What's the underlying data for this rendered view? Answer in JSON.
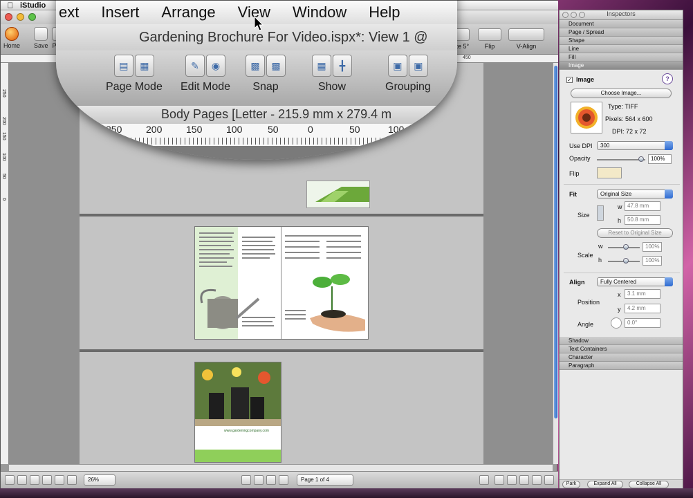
{
  "menubar": {
    "app_name": "iStudio"
  },
  "magnifier": {
    "menu_items": [
      "ext",
      "Insert",
      "Arrange",
      "View",
      "Window",
      "Help"
    ],
    "window_title": "Gardening Brochure For Video.ispx*: View 1 @",
    "tools": [
      {
        "label": "Page Mode"
      },
      {
        "label": "Edit Mode"
      },
      {
        "label": "Snap"
      },
      {
        "label": "Show"
      },
      {
        "label": "Grouping"
      }
    ],
    "header": "Body Pages  [Letter - 215.9 mm x 279.4 m",
    "ruler_ticks": [
      "250",
      "200",
      "150",
      "100",
      "50",
      "0",
      "50",
      "100"
    ]
  },
  "toolbar": {
    "home": "Home",
    "save": "Save",
    "print_partial": "Pr",
    "rotate_partial": "tate 5°",
    "flip": "Flip",
    "valign": "V-Align"
  },
  "ruler": {
    "right_label": "450",
    "left_ticks": [
      "250",
      "200",
      "150",
      "100",
      "50",
      "0"
    ]
  },
  "status": {
    "zoom": "26%",
    "page": "Page 1 of 4"
  },
  "inspector": {
    "title": "Inspectors",
    "sections_top": [
      "Document",
      "Page / Spread",
      "Shape",
      "Line",
      "Fill",
      "Image"
    ],
    "image": {
      "checkbox_label": "Image",
      "choose_button": "Choose Image...",
      "type": "Type:  TIFF",
      "pixels": "Pixels:  564 x 600",
      "dpi": "DPI:  72 x 72",
      "use_dpi_label": "Use DPI",
      "use_dpi_value": "300",
      "opacity_label": "Opacity",
      "opacity_value": "100%",
      "flip_label": "Flip",
      "fit_label": "Fit",
      "fit_value": "Original Size",
      "size_label": "Size",
      "w_label": "w",
      "w_value": "47.8 mm",
      "h_label": "h",
      "h_value": "50.8 mm",
      "reset_button": "Reset to Original Size",
      "scale_label": "Scale",
      "scale_w": "100%",
      "scale_h": "100%",
      "align_label": "Align",
      "align_value": "Fully Centered",
      "position_label": "Position",
      "x_label": "x",
      "x_value": "3.1 mm",
      "y_label": "y",
      "y_value": "4.2 mm",
      "angle_label": "Angle",
      "angle_value": "0.0°",
      "help": "?"
    },
    "sections_bottom": [
      "Shadow",
      "Text Containers",
      "Character",
      "Paragraph"
    ],
    "footer": [
      "Park",
      "Expand All",
      "Collapse All"
    ]
  },
  "brochure": {
    "url_text": "www.gardeningcompany.com"
  },
  "colors": {
    "accent_blue": "#2e6bd1",
    "leaf_green": "#4caf3a",
    "page_bg": "#c4c4c4"
  }
}
